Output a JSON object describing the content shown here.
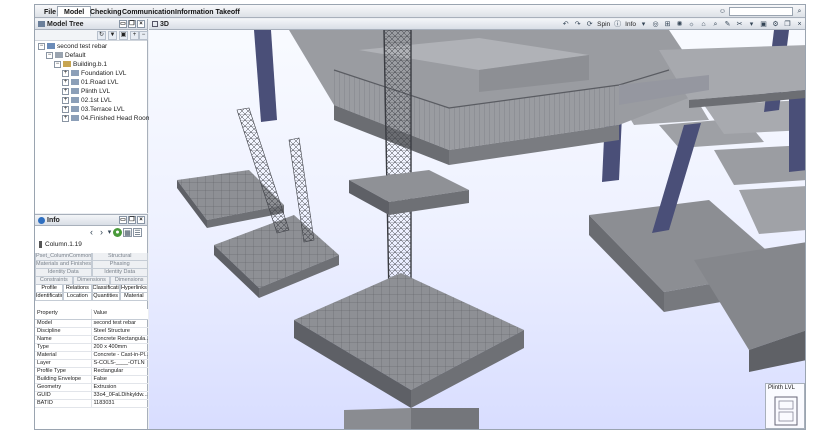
{
  "menu": {
    "tabs": [
      {
        "label": "File",
        "active": false
      },
      {
        "label": "Model",
        "active": true
      },
      {
        "label": "Checking",
        "active": false
      },
      {
        "label": "Communication",
        "active": false
      },
      {
        "label": "Information Takeoff",
        "active": false
      }
    ]
  },
  "model_tree": {
    "title": "Model Tree",
    "items": [
      {
        "label": "second test rebar",
        "level": 0,
        "expander": "−"
      },
      {
        "label": "Default",
        "level": 1,
        "expander": "−"
      },
      {
        "label": "Building.b.1",
        "level": 2,
        "expander": "−"
      },
      {
        "label": "Foundation LVL",
        "level": 3,
        "expander": "+"
      },
      {
        "label": "01.Road LVL",
        "level": 3,
        "expander": "+"
      },
      {
        "label": "Plinth LVL",
        "level": 3,
        "expander": "+"
      },
      {
        "label": "02.1st LVL",
        "level": 3,
        "expander": "+"
      },
      {
        "label": "03.Terrace LVL",
        "level": 3,
        "expander": "+"
      },
      {
        "label": "04.Finished Head Room LVL",
        "level": 3,
        "expander": "+"
      }
    ]
  },
  "info": {
    "title": "Info",
    "element_name": "Column.1.19",
    "tab_rows": [
      [
        "Pset_ColumnCommon",
        "Structural"
      ],
      [
        "Materials and Finishes",
        "Phasing"
      ],
      [
        "Identity Data",
        "Identity Data"
      ],
      [
        "Constraints",
        "Dimensions",
        "Dimensions"
      ],
      [
        "Profile",
        "Relations",
        "Classification",
        "Hyperlinks"
      ],
      [
        "Identification",
        "Location",
        "Quantities",
        "Material"
      ]
    ],
    "columns": {
      "property": "Property",
      "value": "Value"
    },
    "properties": [
      {
        "k": "Model",
        "v": "second test rebar"
      },
      {
        "k": "Discipline",
        "v": "Steel Structure"
      },
      {
        "k": "Name",
        "v": "Concrete Rectangula..."
      },
      {
        "k": "Type",
        "v": "200 x 400mm"
      },
      {
        "k": "Material",
        "v": "Concrete - Cast-in-Pl..."
      },
      {
        "k": "Layer",
        "v": "S-COLS-____-OTLN"
      },
      {
        "k": "Profile Type",
        "v": "Rectangular"
      },
      {
        "k": "Building Envelope",
        "v": "False"
      },
      {
        "k": "Geometry",
        "v": "Extrusion"
      },
      {
        "k": "GUID",
        "v": "33o4_0FaLDihkyldw..."
      },
      {
        "k": "BATID",
        "v": "1183031"
      }
    ]
  },
  "viewport": {
    "title": "3D",
    "spin_label": "Spin",
    "info_label": "Info",
    "minimap_level": "Plinth LVL"
  },
  "colors": {
    "steel_column": "#4a4f78",
    "concrete": "#8f9196",
    "concrete_dark": "#5e6066",
    "sky_bottom": "#d8ddff"
  }
}
